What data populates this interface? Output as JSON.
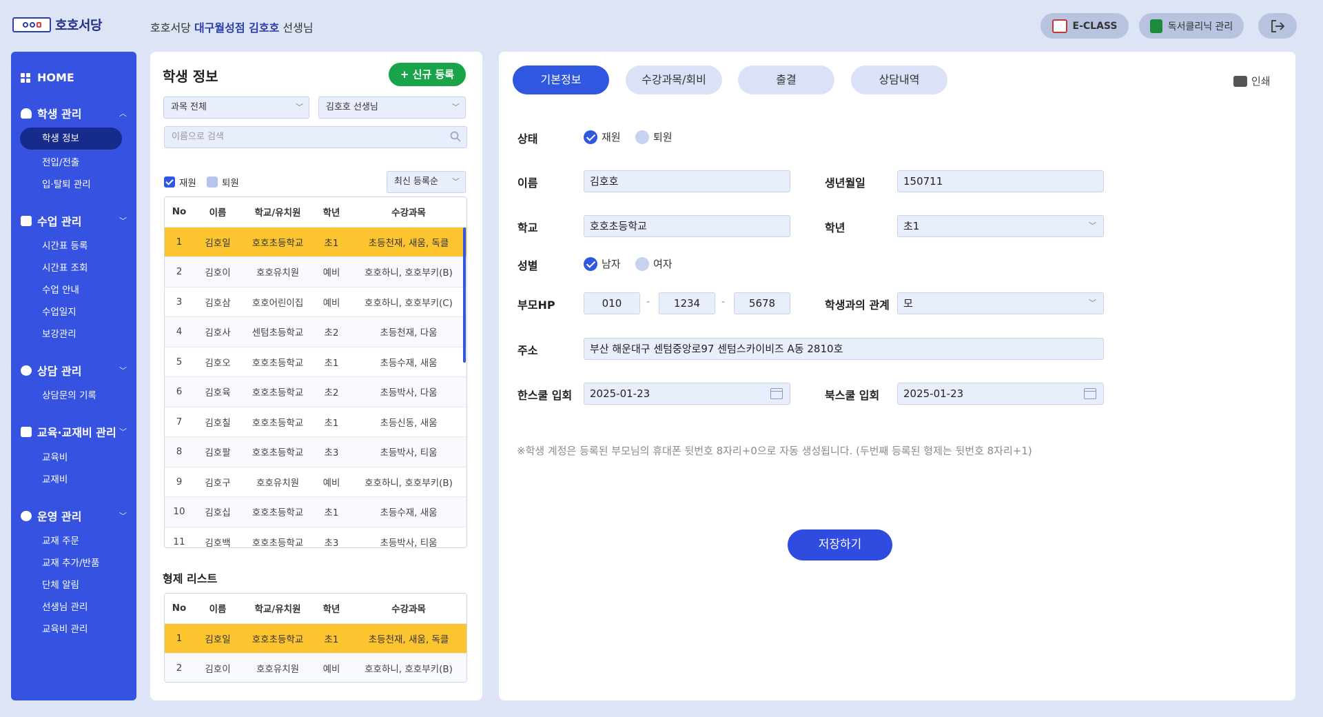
{
  "header": {
    "logo_text": "호호서당",
    "greeting_prefix": "호호서당 ",
    "greeting_branch": "대구월성점 김호호",
    "greeting_suffix": " 선생님",
    "eclass_label": "E-CLASS",
    "clinic_label": "독서클리닉 관리"
  },
  "sidebar": {
    "home": "HOME",
    "sections": [
      {
        "label": "학생 관리",
        "items": [
          "학생 정보",
          "전입/전출",
          "입·탈퇴 관리"
        ]
      },
      {
        "label": "수업 관리",
        "items": [
          "시간표 등록",
          "시간표 조회",
          "수업 안내",
          "수업일지",
          "보강관리"
        ]
      },
      {
        "label": "상담 관리",
        "items": [
          "상담문의 기록"
        ]
      },
      {
        "label": "교육·교재비 관리",
        "items": [
          "교육비",
          "교재비"
        ]
      },
      {
        "label": "운영 관리",
        "items": [
          "교재 주문",
          "교재 추가/반품",
          "단체 알림",
          "선생님 관리",
          "교육비 관리"
        ]
      }
    ]
  },
  "student_panel": {
    "title": "학생 정보",
    "new_button": "+ 신규 등록",
    "subject_filter": "과목 전체",
    "teacher_filter": "김호호 선생님",
    "search_placeholder": "이름으로 검색",
    "filter_enrolled": "재원",
    "filter_withdrawn": "퇴원",
    "sort": "최신 등록순",
    "columns": [
      "No",
      "이름",
      "학교/유치원",
      "학년",
      "수강과목"
    ],
    "rows": [
      [
        "1",
        "김호일",
        "호호초등학교",
        "초1",
        "초등천재, 새움, 독클"
      ],
      [
        "2",
        "김호이",
        "호호유치원",
        "예비",
        "호호하니, 호호부키(B)"
      ],
      [
        "3",
        "김호삼",
        "호호어린이집",
        "예비",
        "호호하니, 호호부키(C)"
      ],
      [
        "4",
        "김호사",
        "센텀초등학교",
        "초2",
        "초등천재, 다움"
      ],
      [
        "5",
        "김호오",
        "호호초등학교",
        "초1",
        "초등수재, 새움"
      ],
      [
        "6",
        "김호육",
        "호호초등학교",
        "초2",
        "초등박사, 다움"
      ],
      [
        "7",
        "김호칠",
        "호호초등학교",
        "초1",
        "초등신동, 새움"
      ],
      [
        "8",
        "김호팔",
        "호호초등학교",
        "초3",
        "초등박사, 티움"
      ],
      [
        "9",
        "김호구",
        "호호유치원",
        "예비",
        "호호하니, 호호부키(B)"
      ],
      [
        "10",
        "김호십",
        "호호초등학교",
        "초1",
        "초등수재, 새움"
      ],
      [
        "11",
        "김호백",
        "호호초등학교",
        "초3",
        "초등박사, 티움"
      ]
    ],
    "sibling_title": "형제 리스트",
    "sibling_rows": [
      [
        "1",
        "김호일",
        "호호초등학교",
        "초1",
        "초등천재, 새움, 독클"
      ],
      [
        "2",
        "김호이",
        "호호유치원",
        "예비",
        "호호하니, 호호부키(B)"
      ]
    ]
  },
  "detail": {
    "tabs": [
      "기본정보",
      "수강과목/회비",
      "출결",
      "상담내역"
    ],
    "print": "인쇄",
    "labels": {
      "status": "상태",
      "name": "이름",
      "birth": "생년월일",
      "school": "학교",
      "grade": "학년",
      "gender": "성별",
      "parent_phone": "부모HP",
      "relation": "학생과의 관계",
      "address": "주소",
      "hanschool": "한스쿨 입회",
      "bookschool": "북스쿨 입회"
    },
    "status_options": [
      "재원",
      "퇴원"
    ],
    "gender_options": [
      "남자",
      "여자"
    ],
    "values": {
      "name": "김호호",
      "birth": "150711",
      "school": "호호초등학교",
      "grade": "초1",
      "phone1": "010",
      "phone2": "1234",
      "phone3": "5678",
      "relation": "모",
      "address": "부산 해운대구 센텀중앙로97 센텀스카이비즈 A동 2810호",
      "hanschool_date": "2025-01-23",
      "bookschool_date": "2025-01-23"
    },
    "note": "※학생 계정은 등록된 부모님의 휴대폰 뒷번호 8자리+0으로 자동 생성됩니다. (두번째 등록된 형제는 뒷번호 8자리+1)",
    "save": "저장하기"
  }
}
